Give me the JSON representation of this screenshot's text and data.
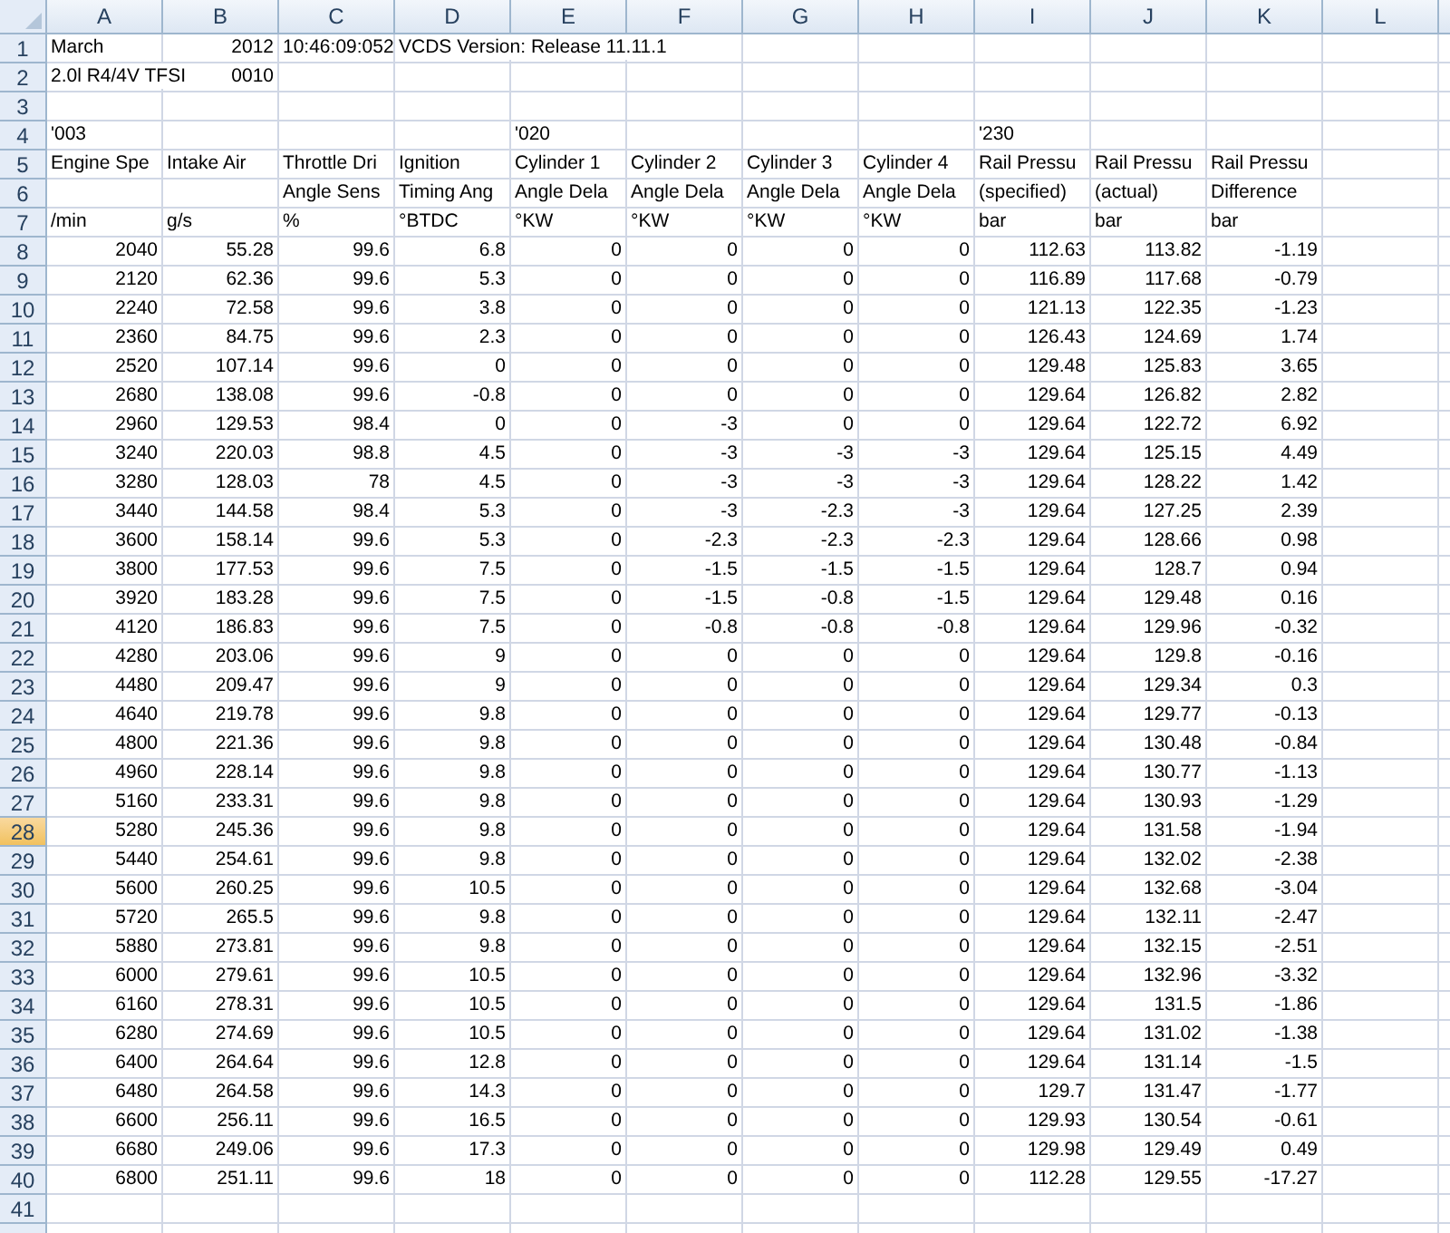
{
  "columns": [
    {
      "label": "A",
      "selected": false
    },
    {
      "label": "B",
      "selected": false
    },
    {
      "label": "C",
      "selected": false
    },
    {
      "label": "D",
      "selected": false
    },
    {
      "label": "E",
      "selected": false
    },
    {
      "label": "F",
      "selected": false
    },
    {
      "label": "G",
      "selected": false
    },
    {
      "label": "H",
      "selected": false
    },
    {
      "label": "I",
      "selected": false
    },
    {
      "label": "J",
      "selected": false
    },
    {
      "label": "K",
      "selected": false
    },
    {
      "label": "L",
      "selected": false
    }
  ],
  "rows": [
    {
      "number": "1",
      "selected": false,
      "cells": {
        "A": "March",
        "B": "2012",
        "C": "10:46:09:052",
        "D": "VCDS Version: Release 11.11.1"
      }
    },
    {
      "number": "2",
      "selected": false,
      "cells": {
        "A": "2.0l R4/4V TFSI",
        "B": "0010"
      }
    },
    {
      "number": "3",
      "selected": false,
      "cells": {}
    },
    {
      "number": "4",
      "selected": false,
      "cells": {
        "A": "'003",
        "E": "'020",
        "I": "'230"
      }
    },
    {
      "number": "5",
      "selected": false,
      "cells": {
        "A": "Engine Spe",
        "B": "Intake Air",
        "C": "Throttle Dri",
        "D": "Ignition",
        "E": "Cylinder 1",
        "F": "Cylinder 2",
        "G": "Cylinder 3",
        "H": "Cylinder 4",
        "I": "Rail Pressu",
        "J": "Rail Pressu",
        "K": "Rail Pressu"
      }
    },
    {
      "number": "6",
      "selected": false,
      "cells": {
        "C": "Angle Sens",
        "D": "Timing Ang",
        "E": "Angle Dela",
        "F": "Angle Dela",
        "G": "Angle Dela",
        "H": "Angle Dela",
        "I": "(specified)",
        "J": "(actual)",
        "K": "Difference"
      }
    },
    {
      "number": "7",
      "selected": false,
      "cells": {
        "A": "/min",
        "B": "g/s",
        "C": "%",
        "D": "°BTDC",
        "E": "°KW",
        "F": "°KW",
        "G": "°KW",
        "H": "°KW",
        "I": "bar",
        "J": "bar",
        "K": "bar"
      }
    },
    {
      "number": "8",
      "selected": false,
      "cells": {
        "A": "2040",
        "B": "55.28",
        "C": "99.6",
        "D": "6.8",
        "E": "0",
        "F": "0",
        "G": "0",
        "H": "0",
        "I": "112.63",
        "J": "113.82",
        "K": "-1.19"
      }
    },
    {
      "number": "9",
      "selected": false,
      "cells": {
        "A": "2120",
        "B": "62.36",
        "C": "99.6",
        "D": "5.3",
        "E": "0",
        "F": "0",
        "G": "0",
        "H": "0",
        "I": "116.89",
        "J": "117.68",
        "K": "-0.79"
      }
    },
    {
      "number": "10",
      "selected": false,
      "cells": {
        "A": "2240",
        "B": "72.58",
        "C": "99.6",
        "D": "3.8",
        "E": "0",
        "F": "0",
        "G": "0",
        "H": "0",
        "I": "121.13",
        "J": "122.35",
        "K": "-1.23"
      }
    },
    {
      "number": "11",
      "selected": false,
      "cells": {
        "A": "2360",
        "B": "84.75",
        "C": "99.6",
        "D": "2.3",
        "E": "0",
        "F": "0",
        "G": "0",
        "H": "0",
        "I": "126.43",
        "J": "124.69",
        "K": "1.74"
      }
    },
    {
      "number": "12",
      "selected": false,
      "cells": {
        "A": "2520",
        "B": "107.14",
        "C": "99.6",
        "D": "0",
        "E": "0",
        "F": "0",
        "G": "0",
        "H": "0",
        "I": "129.48",
        "J": "125.83",
        "K": "3.65"
      }
    },
    {
      "number": "13",
      "selected": false,
      "cells": {
        "A": "2680",
        "B": "138.08",
        "C": "99.6",
        "D": "-0.8",
        "E": "0",
        "F": "0",
        "G": "0",
        "H": "0",
        "I": "129.64",
        "J": "126.82",
        "K": "2.82"
      }
    },
    {
      "number": "14",
      "selected": false,
      "cells": {
        "A": "2960",
        "B": "129.53",
        "C": "98.4",
        "D": "0",
        "E": "0",
        "F": "-3",
        "G": "0",
        "H": "0",
        "I": "129.64",
        "J": "122.72",
        "K": "6.92"
      }
    },
    {
      "number": "15",
      "selected": false,
      "cells": {
        "A": "3240",
        "B": "220.03",
        "C": "98.8",
        "D": "4.5",
        "E": "0",
        "F": "-3",
        "G": "-3",
        "H": "-3",
        "I": "129.64",
        "J": "125.15",
        "K": "4.49"
      }
    },
    {
      "number": "16",
      "selected": false,
      "cells": {
        "A": "3280",
        "B": "128.03",
        "C": "78",
        "D": "4.5",
        "E": "0",
        "F": "-3",
        "G": "-3",
        "H": "-3",
        "I": "129.64",
        "J": "128.22",
        "K": "1.42"
      }
    },
    {
      "number": "17",
      "selected": false,
      "cells": {
        "A": "3440",
        "B": "144.58",
        "C": "98.4",
        "D": "5.3",
        "E": "0",
        "F": "-3",
        "G": "-2.3",
        "H": "-3",
        "I": "129.64",
        "J": "127.25",
        "K": "2.39"
      }
    },
    {
      "number": "18",
      "selected": false,
      "cells": {
        "A": "3600",
        "B": "158.14",
        "C": "99.6",
        "D": "5.3",
        "E": "0",
        "F": "-2.3",
        "G": "-2.3",
        "H": "-2.3",
        "I": "129.64",
        "J": "128.66",
        "K": "0.98"
      }
    },
    {
      "number": "19",
      "selected": false,
      "cells": {
        "A": "3800",
        "B": "177.53",
        "C": "99.6",
        "D": "7.5",
        "E": "0",
        "F": "-1.5",
        "G": "-1.5",
        "H": "-1.5",
        "I": "129.64",
        "J": "128.7",
        "K": "0.94"
      }
    },
    {
      "number": "20",
      "selected": false,
      "cells": {
        "A": "3920",
        "B": "183.28",
        "C": "99.6",
        "D": "7.5",
        "E": "0",
        "F": "-1.5",
        "G": "-0.8",
        "H": "-1.5",
        "I": "129.64",
        "J": "129.48",
        "K": "0.16"
      }
    },
    {
      "number": "21",
      "selected": false,
      "cells": {
        "A": "4120",
        "B": "186.83",
        "C": "99.6",
        "D": "7.5",
        "E": "0",
        "F": "-0.8",
        "G": "-0.8",
        "H": "-0.8",
        "I": "129.64",
        "J": "129.96",
        "K": "-0.32"
      }
    },
    {
      "number": "22",
      "selected": false,
      "cells": {
        "A": "4280",
        "B": "203.06",
        "C": "99.6",
        "D": "9",
        "E": "0",
        "F": "0",
        "G": "0",
        "H": "0",
        "I": "129.64",
        "J": "129.8",
        "K": "-0.16"
      }
    },
    {
      "number": "23",
      "selected": false,
      "cells": {
        "A": "4480",
        "B": "209.47",
        "C": "99.6",
        "D": "9",
        "E": "0",
        "F": "0",
        "G": "0",
        "H": "0",
        "I": "129.64",
        "J": "129.34",
        "K": "0.3"
      }
    },
    {
      "number": "24",
      "selected": false,
      "cells": {
        "A": "4640",
        "B": "219.78",
        "C": "99.6",
        "D": "9.8",
        "E": "0",
        "F": "0",
        "G": "0",
        "H": "0",
        "I": "129.64",
        "J": "129.77",
        "K": "-0.13"
      }
    },
    {
      "number": "25",
      "selected": false,
      "cells": {
        "A": "4800",
        "B": "221.36",
        "C": "99.6",
        "D": "9.8",
        "E": "0",
        "F": "0",
        "G": "0",
        "H": "0",
        "I": "129.64",
        "J": "130.48",
        "K": "-0.84"
      }
    },
    {
      "number": "26",
      "selected": false,
      "cells": {
        "A": "4960",
        "B": "228.14",
        "C": "99.6",
        "D": "9.8",
        "E": "0",
        "F": "0",
        "G": "0",
        "H": "0",
        "I": "129.64",
        "J": "130.77",
        "K": "-1.13"
      }
    },
    {
      "number": "27",
      "selected": false,
      "cells": {
        "A": "5160",
        "B": "233.31",
        "C": "99.6",
        "D": "9.8",
        "E": "0",
        "F": "0",
        "G": "0",
        "H": "0",
        "I": "129.64",
        "J": "130.93",
        "K": "-1.29"
      }
    },
    {
      "number": "28",
      "selected": true,
      "cells": {
        "A": "5280",
        "B": "245.36",
        "C": "99.6",
        "D": "9.8",
        "E": "0",
        "F": "0",
        "G": "0",
        "H": "0",
        "I": "129.64",
        "J": "131.58",
        "K": "-1.94"
      }
    },
    {
      "number": "29",
      "selected": false,
      "cells": {
        "A": "5440",
        "B": "254.61",
        "C": "99.6",
        "D": "9.8",
        "E": "0",
        "F": "0",
        "G": "0",
        "H": "0",
        "I": "129.64",
        "J": "132.02",
        "K": "-2.38"
      }
    },
    {
      "number": "30",
      "selected": false,
      "cells": {
        "A": "5600",
        "B": "260.25",
        "C": "99.6",
        "D": "10.5",
        "E": "0",
        "F": "0",
        "G": "0",
        "H": "0",
        "I": "129.64",
        "J": "132.68",
        "K": "-3.04"
      }
    },
    {
      "number": "31",
      "selected": false,
      "cells": {
        "A": "5720",
        "B": "265.5",
        "C": "99.6",
        "D": "9.8",
        "E": "0",
        "F": "0",
        "G": "0",
        "H": "0",
        "I": "129.64",
        "J": "132.11",
        "K": "-2.47"
      }
    },
    {
      "number": "32",
      "selected": false,
      "cells": {
        "A": "5880",
        "B": "273.81",
        "C": "99.6",
        "D": "9.8",
        "E": "0",
        "F": "0",
        "G": "0",
        "H": "0",
        "I": "129.64",
        "J": "132.15",
        "K": "-2.51"
      }
    },
    {
      "number": "33",
      "selected": false,
      "cells": {
        "A": "6000",
        "B": "279.61",
        "C": "99.6",
        "D": "10.5",
        "E": "0",
        "F": "0",
        "G": "0",
        "H": "0",
        "I": "129.64",
        "J": "132.96",
        "K": "-3.32"
      }
    },
    {
      "number": "34",
      "selected": false,
      "cells": {
        "A": "6160",
        "B": "278.31",
        "C": "99.6",
        "D": "10.5",
        "E": "0",
        "F": "0",
        "G": "0",
        "H": "0",
        "I": "129.64",
        "J": "131.5",
        "K": "-1.86"
      }
    },
    {
      "number": "35",
      "selected": false,
      "cells": {
        "A": "6280",
        "B": "274.69",
        "C": "99.6",
        "D": "10.5",
        "E": "0",
        "F": "0",
        "G": "0",
        "H": "0",
        "I": "129.64",
        "J": "131.02",
        "K": "-1.38"
      }
    },
    {
      "number": "36",
      "selected": false,
      "cells": {
        "A": "6400",
        "B": "264.64",
        "C": "99.6",
        "D": "12.8",
        "E": "0",
        "F": "0",
        "G": "0",
        "H": "0",
        "I": "129.64",
        "J": "131.14",
        "K": "-1.5"
      }
    },
    {
      "number": "37",
      "selected": false,
      "cells": {
        "A": "6480",
        "B": "264.58",
        "C": "99.6",
        "D": "14.3",
        "E": "0",
        "F": "0",
        "G": "0",
        "H": "0",
        "I": "129.7",
        "J": "131.47",
        "K": "-1.77"
      }
    },
    {
      "number": "38",
      "selected": false,
      "cells": {
        "A": "6600",
        "B": "256.11",
        "C": "99.6",
        "D": "16.5",
        "E": "0",
        "F": "0",
        "G": "0",
        "H": "0",
        "I": "129.93",
        "J": "130.54",
        "K": "-0.61"
      }
    },
    {
      "number": "39",
      "selected": false,
      "cells": {
        "A": "6680",
        "B": "249.06",
        "C": "99.6",
        "D": "17.3",
        "E": "0",
        "F": "0",
        "G": "0",
        "H": "0",
        "I": "129.98",
        "J": "129.49",
        "K": "0.49"
      }
    },
    {
      "number": "40",
      "selected": false,
      "cells": {
        "A": "6800",
        "B": "251.11",
        "C": "99.6",
        "D": "18",
        "E": "0",
        "F": "0",
        "G": "0",
        "H": "0",
        "I": "112.28",
        "J": "129.55",
        "K": "-17.27"
      }
    },
    {
      "number": "41",
      "selected": false,
      "cells": {}
    }
  ]
}
